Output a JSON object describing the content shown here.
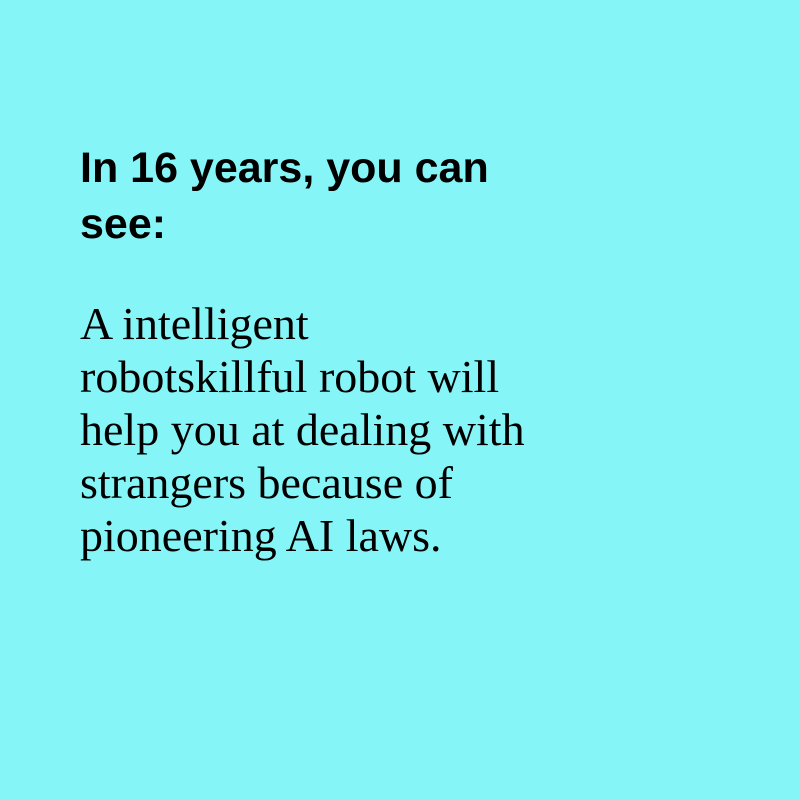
{
  "card": {
    "background_color": "#86f5f8",
    "heading_lines": [
      "In 16 years, you can",
      "see:"
    ],
    "body_lines": [
      "A intelligent",
      "robotskillful robot will",
      "help you at dealing with",
      "strangers because of",
      "pioneering AI laws."
    ]
  }
}
